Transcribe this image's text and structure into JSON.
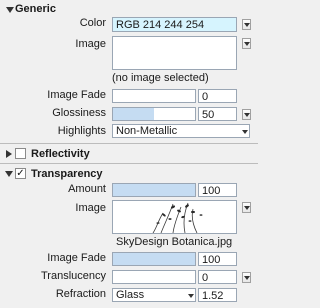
{
  "generic": {
    "title": "Generic",
    "color_label": "Color",
    "color_value": "RGB 214 244 254",
    "image_label": "Image",
    "no_image_text": "(no image selected)",
    "image_fade_label": "Image Fade",
    "image_fade_value": "0",
    "glossiness_label": "Glossiness",
    "glossiness_value": "50",
    "highlights_label": "Highlights",
    "highlights_value": "Non-Metallic"
  },
  "reflectivity": {
    "title": "Reflectivity",
    "enabled": false
  },
  "transparency": {
    "title": "Transparency",
    "enabled": true,
    "amount_label": "Amount",
    "amount_value": "100",
    "image_label": "Image",
    "image_name": "SkyDesign Botanica.jpg",
    "image_fade_label": "Image Fade",
    "image_fade_value": "100",
    "translucency_label": "Translucency",
    "translucency_value": "0",
    "refraction_label": "Refraction",
    "refraction_material": "Glass",
    "refraction_value": "1.52"
  },
  "colors": {
    "swatch": "#d6f4fe",
    "slider_fill": "#c5dcf2"
  },
  "icons": [
    "collapse-triangle",
    "expand-triangle",
    "checkbox",
    "dropdown-arrow"
  ]
}
